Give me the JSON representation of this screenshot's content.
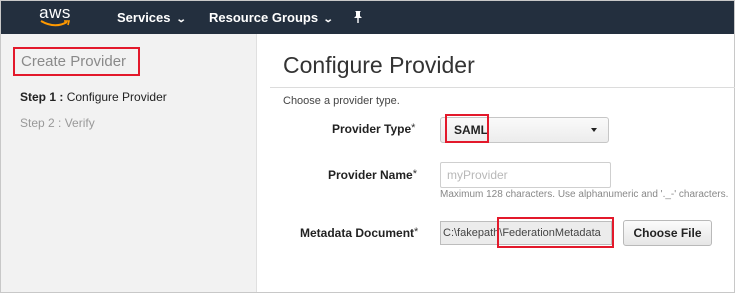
{
  "topnav": {
    "logo_text": "aws",
    "services_label": "Services",
    "resource_groups_label": "Resource Groups"
  },
  "sidebar": {
    "title": "Create Provider",
    "steps": [
      {
        "prefix": "Step 1 :",
        "label": "Configure Provider",
        "active": true
      },
      {
        "label": "Step 2 : Verify",
        "active": false
      }
    ]
  },
  "main": {
    "title": "Configure Provider",
    "subtitle": "Choose a provider type.",
    "required_marker": "*",
    "provider_type": {
      "label": "Provider Type",
      "value": "SAML"
    },
    "provider_name": {
      "label": "Provider Name",
      "placeholder": "myProvider",
      "value": "",
      "hint": "Maximum 128 characters. Use alphanumeric and '._-' characters."
    },
    "metadata_document": {
      "label": "Metadata Document",
      "file_value": "C:\\fakepath\\FederationMetadata",
      "button_label": "Choose File"
    }
  },
  "colors": {
    "nav_bg": "#232f3e",
    "highlight": "#e3192b",
    "sidebar_bg": "#f2f2f2"
  }
}
